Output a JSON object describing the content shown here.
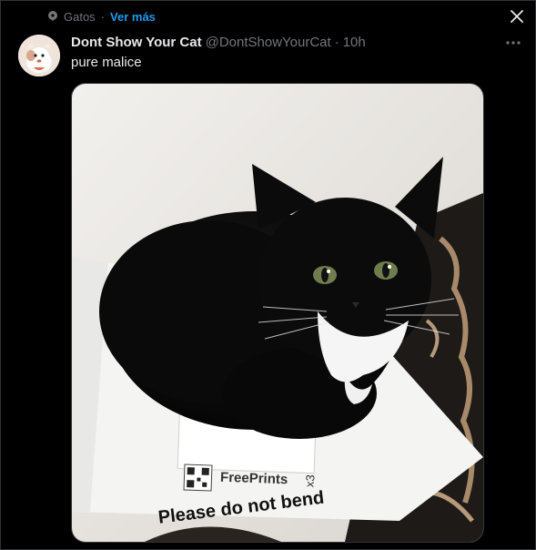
{
  "context": {
    "community": "Gatos",
    "separator": "·",
    "more_link": "Ver más"
  },
  "tweet": {
    "display_name": "Dont Show Your Cat",
    "handle": "@DontShowYourCat",
    "separator": "·",
    "time": "10h",
    "text": "pure malice"
  },
  "media": {
    "paper_text": "Please do not bend",
    "brand": "FreePrints",
    "brand_mark": "x3"
  },
  "icons": {
    "close": "close-icon",
    "more": "more-icon",
    "community": "community-icon"
  },
  "colors": {
    "background": "#000000",
    "accent": "#1d9bf0",
    "secondary_text": "#71767b",
    "primary_text": "#e7e9ea"
  }
}
